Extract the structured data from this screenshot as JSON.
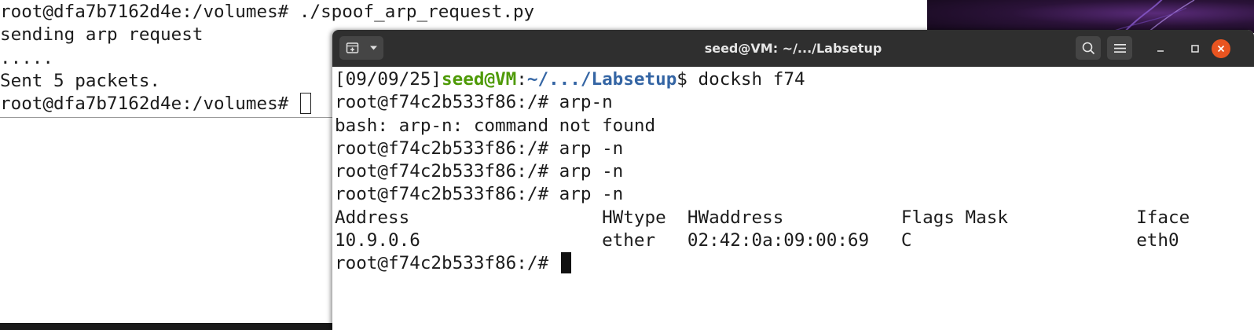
{
  "background_terminal": {
    "lines": [
      "root@dfa7b7162d4e:/volumes# ./spoof_arp_request.py",
      "sending arp request",
      ".....",
      "Sent 5 packets."
    ],
    "prompt_line": "root@dfa7b7162d4e:/volumes# "
  },
  "terminal_window": {
    "title": "seed@VM: ~/.../Labsetup",
    "new_tab_icon": "new-tab-icon",
    "menu_icon": "hamburger-menu-icon",
    "colors": {
      "titlebar": "#2f2f2f",
      "close": "#e95420",
      "prompt_user": "#4e9a06",
      "prompt_path": "#3465a4"
    }
  },
  "terminal_output": {
    "first_prompt": {
      "date": "[09/09/25]",
      "user": "seed@VM",
      "colon": ":",
      "path": "~/.../Labsetup",
      "dollar": "$ ",
      "command": "docksh f74"
    },
    "lines": [
      "root@f74c2b533f86:/# arp-n",
      "bash: arp-n: command not found",
      "root@f74c2b533f86:/# arp -n",
      "root@f74c2b533f86:/# arp -n",
      "root@f74c2b533f86:/# arp -n",
      "Address                  HWtype  HWaddress           Flags Mask            Iface",
      "10.9.0.6                 ether   02:42:0a:09:00:69   C                     eth0"
    ],
    "prompt_line": "root@f74c2b533f86:/# "
  }
}
